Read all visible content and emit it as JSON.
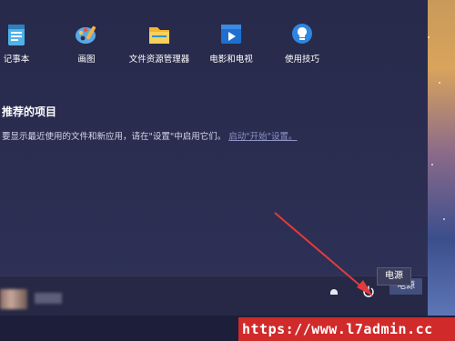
{
  "apps": [
    {
      "label": "记事本",
      "icon": "notepad-icon"
    },
    {
      "label": "画图",
      "icon": "paint-icon"
    },
    {
      "label": "文件资源管理器",
      "icon": "file-explorer-icon"
    },
    {
      "label": "电影和电视",
      "icon": "movies-tv-icon"
    },
    {
      "label": "使用技巧",
      "icon": "tips-icon"
    }
  ],
  "recommended": {
    "title": "推荐的项目",
    "hint_prefix": "要显示最近使用的文件和新应用，请在\"设置\"中启用它们。",
    "hint_link": "启动\"开始\"设置。"
  },
  "power": {
    "tooltip": "电源",
    "label": "电源"
  },
  "watermark": "https://www.l7admin.cc",
  "colors": {
    "menu_bg": "#2a2d50",
    "arrow": "#e23b3b",
    "watermark_bg": "#d12a2a"
  }
}
